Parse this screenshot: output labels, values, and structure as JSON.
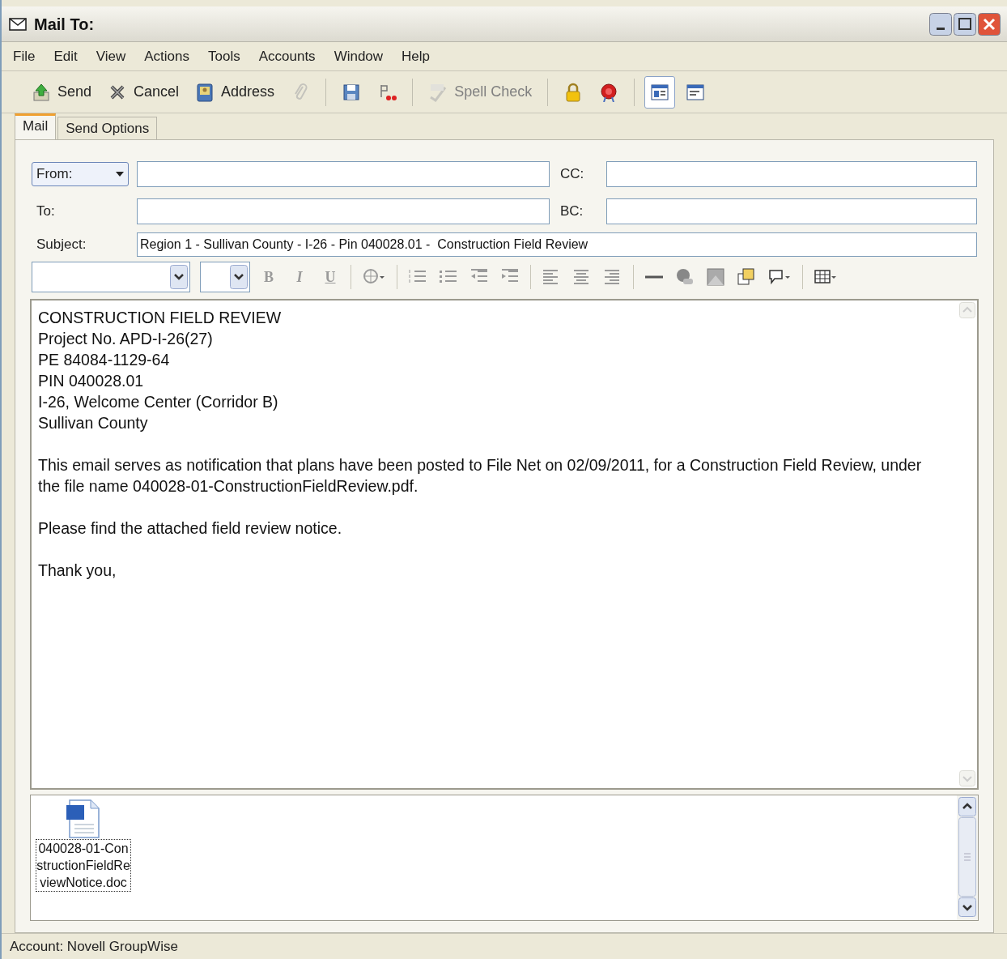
{
  "window": {
    "title": "Mail To:"
  },
  "menu": [
    "File",
    "Edit",
    "View",
    "Actions",
    "Tools",
    "Accounts",
    "Window",
    "Help"
  ],
  "toolbar": [
    {
      "label": "Send",
      "disabled": false
    },
    {
      "label": "Cancel",
      "disabled": false
    },
    {
      "label": "Address",
      "disabled": false
    },
    {
      "disabled": true
    },
    {
      "disabled": false
    },
    {
      "disabled": false
    },
    {
      "label": "Spell Check",
      "disabled": true
    },
    {
      "disabled": false
    },
    {
      "disabled": false
    },
    {
      "disabled": false,
      "selected": true
    },
    {
      "disabled": false,
      "selected": false
    }
  ],
  "tabs": [
    {
      "label": "Mail",
      "selected": true
    },
    {
      "label": "Send Options",
      "selected": false
    }
  ],
  "from": {
    "label": "From:"
  },
  "cc": {
    "label": "CC:"
  },
  "to": {
    "label": "To:"
  },
  "bc": {
    "label": "BC:"
  },
  "subject": {
    "label": "Subject:",
    "value": "Region 1 - Sullivan County - I-26 - Pin 040028.01 -  Construction Field Review"
  },
  "format_bar": {
    "bold": "B",
    "italic": "I",
    "underline": "U"
  },
  "body": [
    {
      "lines": [
        "CONSTRUCTION FIELD REVIEW",
        "Project No. APD-I-26(27)",
        "PE 84084-1129-64",
        "PIN 040028.01",
        "I-26, Welcome Center (Corridor B)",
        "Sullivan County"
      ]
    },
    {
      "lines": [
        "This email serves as notification that plans have been posted to File Net on 02/09/2011, for a Construction Field Review, under the file name 040028-01-ConstructionFieldReview.pdf."
      ]
    },
    {
      "lines": [
        "Please find the attached field review notice."
      ]
    },
    {
      "lines": [
        "Thank you,"
      ]
    }
  ],
  "attachments": [
    {
      "name": "040028-01-ConstructionFieldReviewNotice.doc",
      "selected": true
    }
  ],
  "status_bar": "Account: Novell GroupWise"
}
